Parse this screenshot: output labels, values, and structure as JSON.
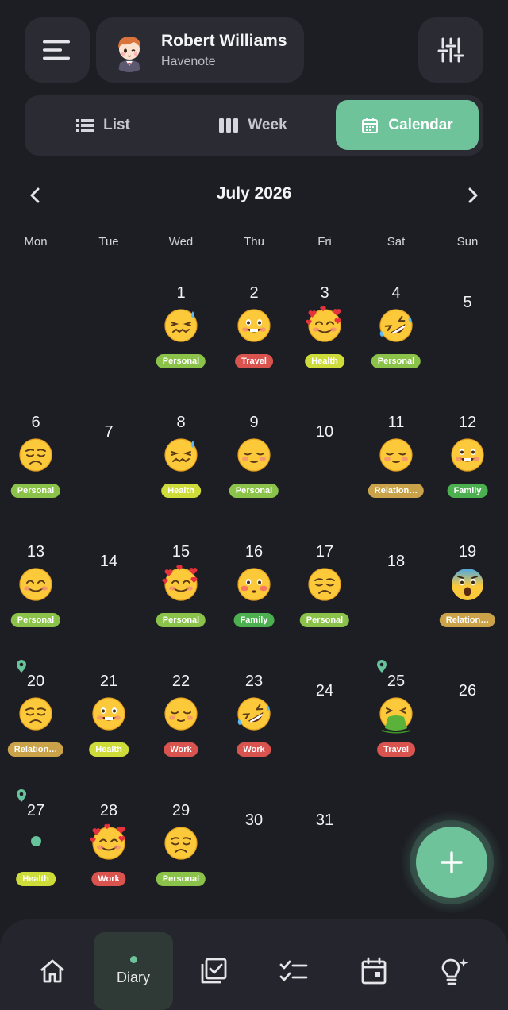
{
  "header": {
    "user_name": "Robert Williams",
    "app_name": "Havenote"
  },
  "view_tabs": [
    {
      "label": "List",
      "active": false
    },
    {
      "label": "Week",
      "active": false
    },
    {
      "label": "Calendar",
      "active": true
    }
  ],
  "calendar": {
    "month_title": "July 2026",
    "weekdays": [
      "Mon",
      "Tue",
      "Wed",
      "Thu",
      "Fri",
      "Sat",
      "Sun"
    ],
    "days": [
      {
        "day": "1",
        "emoji": "grimace-sweat",
        "tag": "Personal",
        "tag_color": "#8bc34a"
      },
      {
        "day": "2",
        "emoji": "grin-teeth",
        "tag": "Travel",
        "tag_color": "#d9534f"
      },
      {
        "day": "3",
        "emoji": "hearts-around",
        "tag": "Health",
        "tag_color": "#cddc39"
      },
      {
        "day": "4",
        "emoji": "rofl",
        "tag": "Personal",
        "tag_color": "#8bc34a"
      },
      {
        "day": "5"
      },
      {
        "day": "6",
        "emoji": "weary",
        "tag": "Personal",
        "tag_color": "#8bc34a"
      },
      {
        "day": "7"
      },
      {
        "day": "8",
        "emoji": "grimace-sweat",
        "tag": "Health",
        "tag_color": "#cddc39"
      },
      {
        "day": "9",
        "emoji": "relieved-blush",
        "tag": "Personal",
        "tag_color": "#8bc34a"
      },
      {
        "day": "10"
      },
      {
        "day": "11",
        "emoji": "relieved-blush",
        "tag": "Relation…",
        "tag_color": "#c9a24a"
      },
      {
        "day": "12",
        "emoji": "grin-teeth",
        "tag": "Family",
        "tag_color": "#4caf50"
      },
      {
        "day": "13",
        "emoji": "smile",
        "tag": "Personal",
        "tag_color": "#8bc34a"
      },
      {
        "day": "14"
      },
      {
        "day": "15",
        "emoji": "hearts-around",
        "tag": "Personal",
        "tag_color": "#8bc34a"
      },
      {
        "day": "16",
        "emoji": "flushed",
        "tag": "Family",
        "tag_color": "#4caf50"
      },
      {
        "day": "17",
        "emoji": "weary",
        "tag": "Personal",
        "tag_color": "#8bc34a"
      },
      {
        "day": "18"
      },
      {
        "day": "19",
        "emoji": "fearful-scream",
        "tag": "Relation…",
        "tag_color": "#c9a24a"
      },
      {
        "day": "20",
        "emoji": "weary",
        "tag": "Relation…",
        "tag_color": "#c9a24a",
        "pin": true
      },
      {
        "day": "21",
        "emoji": "grin-teeth",
        "tag": "Health",
        "tag_color": "#cddc39"
      },
      {
        "day": "22",
        "emoji": "relieved-blush",
        "tag": "Work",
        "tag_color": "#d9534f"
      },
      {
        "day": "23",
        "emoji": "rofl",
        "tag": "Work",
        "tag_color": "#d9534f"
      },
      {
        "day": "24"
      },
      {
        "day": "25",
        "emoji": "vomit",
        "tag": "Travel",
        "tag_color": "#d9534f",
        "pin": true
      },
      {
        "day": "26"
      },
      {
        "day": "27",
        "emoji": "dot",
        "tag": "Health",
        "tag_color": "#cddc39",
        "pin": true
      },
      {
        "day": "28",
        "emoji": "hearts-around",
        "tag": "Work",
        "tag_color": "#d9534f"
      },
      {
        "day": "29",
        "emoji": "weary",
        "tag": "Personal",
        "tag_color": "#8bc34a"
      },
      {
        "day": "30"
      },
      {
        "day": "31"
      }
    ]
  },
  "bottom_nav": [
    {
      "icon": "home-icon",
      "label": ""
    },
    {
      "icon": "diary-icon",
      "label": "Diary",
      "active": true
    },
    {
      "icon": "checklist-book-icon",
      "label": ""
    },
    {
      "icon": "tasks-icon",
      "label": ""
    },
    {
      "icon": "calendar-icon",
      "label": ""
    },
    {
      "icon": "lightbulb-icon",
      "label": ""
    }
  ],
  "colors": {
    "accent": "#6fc39b",
    "background": "#1d1e24",
    "surface": "#2a2b33"
  }
}
